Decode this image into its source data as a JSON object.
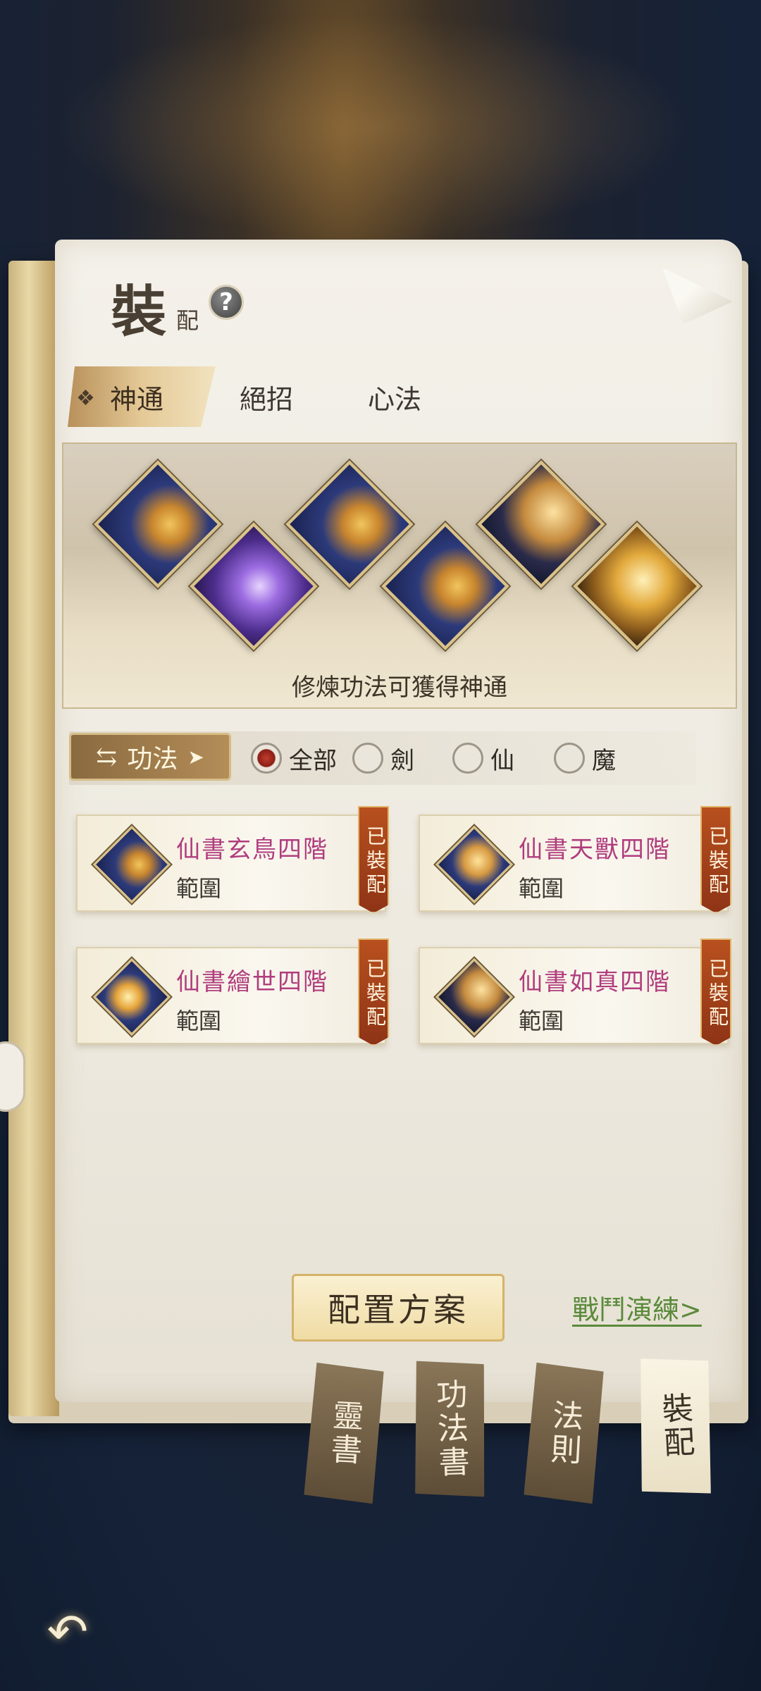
{
  "header": {
    "title": "裝",
    "subtitle": "配",
    "help_icon": "?"
  },
  "tabs": [
    {
      "label": "神通",
      "active": true
    },
    {
      "label": "絕招",
      "active": false
    },
    {
      "label": "心法",
      "active": false
    }
  ],
  "banner": {
    "text": "修煉功法可獲得神通",
    "skills": [
      {
        "icon": "xuanniao-icon",
        "style": "blue"
      },
      {
        "icon": "purple-figure-icon",
        "style": "purple"
      },
      {
        "icon": "beast-icon",
        "style": "blue"
      },
      {
        "icon": "flame-wing-icon",
        "style": "blue"
      },
      {
        "icon": "mountain-icon",
        "style": "mount"
      },
      {
        "icon": "fish-icon",
        "style": "gold"
      }
    ]
  },
  "filter": {
    "label": "功法",
    "options": [
      "全部",
      "劍",
      "仙",
      "魔"
    ],
    "selected": "全部"
  },
  "cards": [
    {
      "name": "仙書玄鳥四階",
      "range": "範圍",
      "badge": "已裝配",
      "icon": "xuanniao-icon"
    },
    {
      "name": "仙書天獸四階",
      "range": "範圍",
      "badge": "已裝配",
      "icon": "beast-icon"
    },
    {
      "name": "仙書繪世四階",
      "range": "範圍",
      "badge": "已裝配",
      "icon": "flame-wing-icon"
    },
    {
      "name": "仙書如真四階",
      "range": "範圍",
      "badge": "已裝配",
      "icon": "mountain-icon"
    }
  ],
  "bottom": {
    "plan_button": "配置方案",
    "battle_link": "戰鬥演練>",
    "book_tabs": [
      {
        "label": "靈書",
        "active": false
      },
      {
        "label": "功法書",
        "active": false
      },
      {
        "label": "法則",
        "active": false
      },
      {
        "label": "裝配",
        "active": true
      }
    ]
  },
  "back_icon": "back-arrow-icon"
}
